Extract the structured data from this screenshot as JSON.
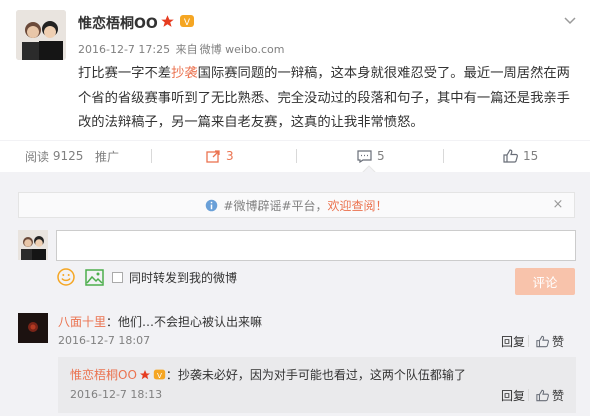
{
  "post": {
    "author": "惟恋梧桐OO",
    "date": "2016-12-7 17:25",
    "source_prefix": "来自",
    "source": "微博 weibo.com",
    "text_before": "打比赛一字不差",
    "text_highlight": "抄袭",
    "text_after": "国际赛同题的一辩稿，这本身就很难忍受了。最近一周居然在两个省的省级赛事听到了无比熟悉、完全没动过的段落和句子，其中有一篇还是我亲手改的法辩稿子，另一篇来自老友赛，这真的让我非常愤怒。"
  },
  "actions": {
    "read_label": "阅读",
    "read_count": "9125",
    "promote_label": "推广",
    "repost_count": "3",
    "comment_count": "5",
    "like_count": "15"
  },
  "notice": {
    "text": "#微博辟谣#平台，",
    "link": "欢迎查阅！",
    "close": "×"
  },
  "composer": {
    "value": "",
    "checkbox_label": "同时转发到我的微博",
    "submit_label": "评论"
  },
  "comments": [
    {
      "author": "八面十里",
      "separator": "：",
      "text": "他们…不会担心被认出来嘛",
      "time": "2016-12-7 18:07",
      "reply_label": "回复",
      "like_label": "赞"
    }
  ],
  "sub_comment": {
    "author": "惟恋梧桐OO",
    "separator": "：",
    "text": "抄袭未必好，因为对手可能也看过，这两个队伍都输了",
    "time": "2016-12-7 18:13",
    "reply_label": "回复",
    "like_label": "赞"
  },
  "colors": {
    "accent": "#eb7350",
    "comment_bg": "#f2f2f5",
    "muted": "#808080"
  }
}
